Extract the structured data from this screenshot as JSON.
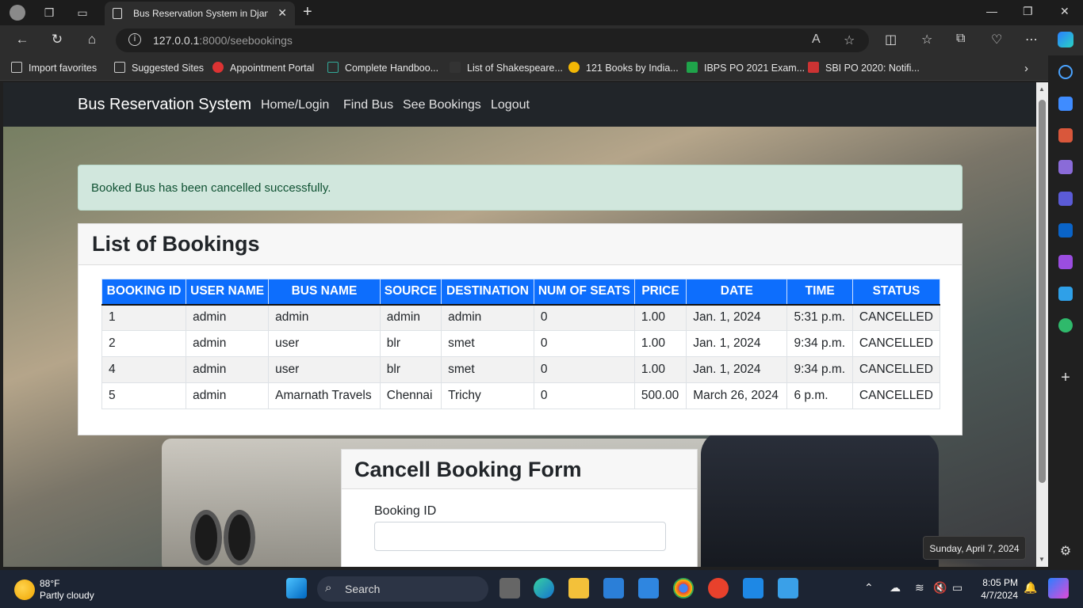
{
  "browser": {
    "tab_title": "Bus Reservation System in Djang",
    "url_host": "127.0.0.1",
    "url_rest": ":8000/seebookings",
    "favorites": [
      {
        "label": "Import favorites"
      },
      {
        "label": "Suggested Sites"
      },
      {
        "label": "Appointment Portal"
      },
      {
        "label": "Complete Handboo..."
      },
      {
        "label": "List of Shakespeare..."
      },
      {
        "label": "121 Books by India..."
      },
      {
        "label": "IBPS PO 2021 Exam..."
      },
      {
        "label": "SBI PO 2020: Notifi..."
      }
    ]
  },
  "site": {
    "brand": "Bus Reservation System",
    "nav": [
      "Home/Login",
      "Find Bus",
      "See Bookings",
      "Logout"
    ],
    "alert": "Booked Bus has been cancelled successfully.",
    "bookings_title": "List of Bookings",
    "columns": [
      "BOOKING ID",
      "USER NAME",
      "BUS NAME",
      "SOURCE",
      "DESTINATION",
      "NUM OF SEATS",
      "PRICE",
      "DATE",
      "TIME",
      "STATUS"
    ],
    "rows": [
      [
        "1",
        "admin",
        "admin",
        "admin",
        "admin",
        "0",
        "1.00",
        "Jan. 1, 2024",
        "5:31 p.m.",
        "CANCELLED"
      ],
      [
        "2",
        "admin",
        "user",
        "blr",
        "smet",
        "0",
        "1.00",
        "Jan. 1, 2024",
        "9:34 p.m.",
        "CANCELLED"
      ],
      [
        "4",
        "admin",
        "user",
        "blr",
        "smet",
        "0",
        "1.00",
        "Jan. 1, 2024",
        "9:34 p.m.",
        "CANCELLED"
      ],
      [
        "5",
        "admin",
        "Amarnath Travels",
        "Chennai",
        "Trichy",
        "0",
        "500.00",
        "March 26, 2024",
        "6 p.m.",
        "CANCELLED"
      ]
    ],
    "cancel_form_title": "Cancell Booking Form",
    "booking_id_label": "Booking ID",
    "booking_id_value": ""
  },
  "tooltip": "Sunday, April 7, 2024",
  "taskbar": {
    "weather_temp": "88°F",
    "weather_desc": "Partly cloudy",
    "search_label": "Search",
    "time": "8:05 PM",
    "date": "4/7/2024"
  },
  "colors": {
    "table_header": "#0d6efd",
    "navbar": "#212529",
    "alert_bg": "#d1e7dd",
    "alert_text": "#0f5132"
  }
}
